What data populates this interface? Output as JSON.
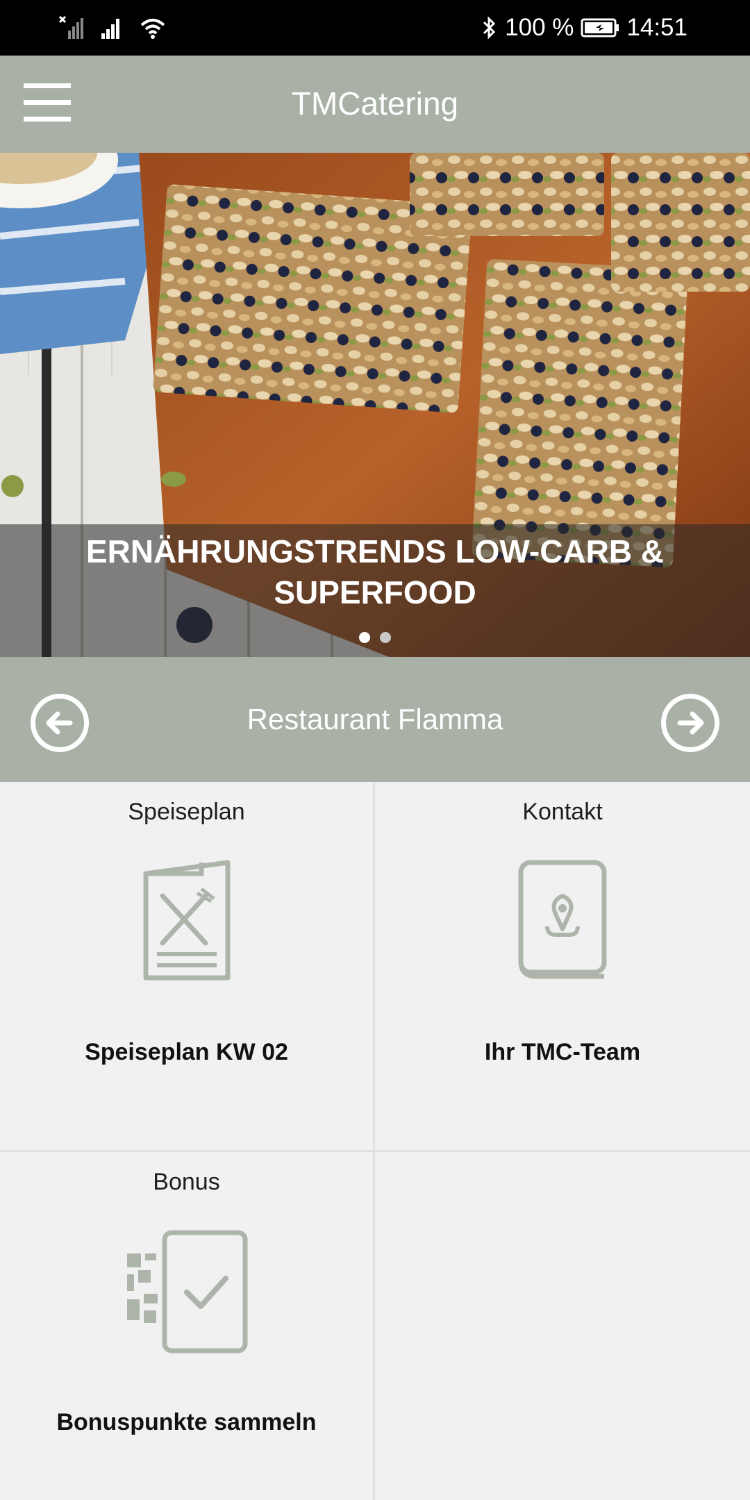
{
  "status_bar": {
    "battery": "100 %",
    "time": "14:51"
  },
  "app_bar": {
    "title": "TMCatering",
    "menu_icon": "hamburger-menu-icon"
  },
  "banner": {
    "caption": "ERNÄHRUNGSTRENDS LOW-CARB & SUPERFOOD",
    "slides_total": 2,
    "active_slide": 1
  },
  "restaurant_nav": {
    "name": "Restaurant Flamma",
    "prev_icon": "arrow-left-circle-icon",
    "next_icon": "arrow-right-circle-icon"
  },
  "tiles": [
    {
      "heading": "Speiseplan",
      "label": "Speiseplan KW 02",
      "icon": "menu-card-icon"
    },
    {
      "heading": "Kontakt",
      "label": "Ihr TMC-Team",
      "icon": "contact-book-icon"
    },
    {
      "heading": "Bonus",
      "label": "Bonuspunkte sammeln",
      "icon": "qr-phone-check-icon"
    }
  ],
  "colors": {
    "accent": "#a9b1a7",
    "icon_gray": "#adb5ab",
    "background": "#f1f1f1"
  }
}
